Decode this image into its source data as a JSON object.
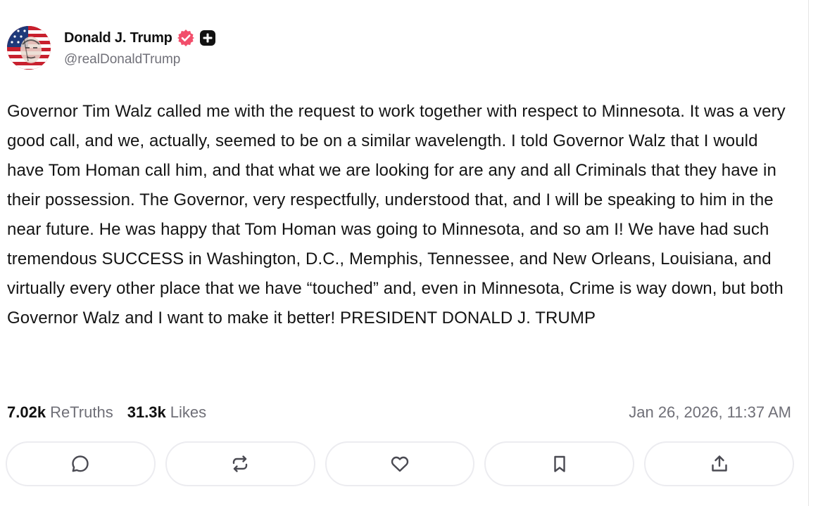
{
  "post": {
    "author": {
      "display_name": "Donald J. Trump",
      "handle": "@realDonaldTrump",
      "avatar_icon": "avatar-flag-portrait",
      "verified_icon": "verified-badge-icon",
      "verified_color": "#f24e6b",
      "plus_icon": "plus-badge-icon"
    },
    "body": "Governor Tim Walz called me with the request to work together with respect to Minnesota. It was a very good call, and we, actually, seemed to be on a similar wavelength. I told Governor Walz that I would have Tom Homan call him, and that what we are looking for are any and all Criminals that they have in their possession. The Governor, very respectfully, understood that, and I will be speaking to him in the near future. He was happy that Tom Homan was going to Minnesota, and so am I! We have had such tremendous SUCCESS in Washington, D.C., Memphis, Tennessee, and New Orleans, Louisiana, and virtually every other place that we have “touched” and, even in Minnesota, Crime is way down, but both Governor Walz and I want to make it better! PRESIDENT DONALD J. TRUMP",
    "stats": {
      "retruths_count": "7.02k",
      "retruths_label": "ReTruths",
      "likes_count": "31.3k",
      "likes_label": "Likes"
    },
    "timestamp": "Jan 26, 2026, 11:37 AM",
    "actions": [
      {
        "name": "reply",
        "icon": "comment-icon"
      },
      {
        "name": "retruth",
        "icon": "repost-icon"
      },
      {
        "name": "like",
        "icon": "heart-icon"
      },
      {
        "name": "bookmark",
        "icon": "bookmark-icon"
      },
      {
        "name": "share",
        "icon": "share-icon"
      }
    ]
  },
  "colors": {
    "text": "#141414",
    "muted": "#6f6f77",
    "border": "#ececf0"
  }
}
